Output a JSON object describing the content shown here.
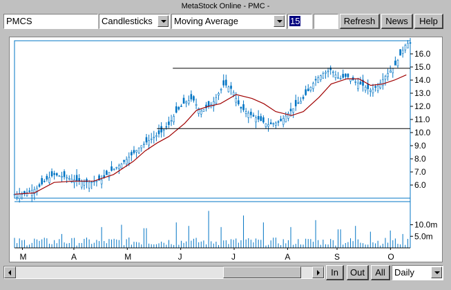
{
  "window": {
    "title": "MetaStock Online - PMC -"
  },
  "toolbar": {
    "symbol": "PMCS",
    "chart_style": "Candlesticks",
    "indicator": "Moving Average",
    "period": "15",
    "refresh_label": "Refresh",
    "news_label": "News",
    "help_label": "Help"
  },
  "bottom": {
    "in_label": "In",
    "out_label": "Out",
    "all_label": "All",
    "periodicity": "Daily"
  },
  "colors": {
    "price": "#0074c4",
    "moving_average": "#a00000",
    "volume": "#0074c4",
    "lines": "#000000"
  },
  "chart_data": {
    "type": "candlestick",
    "x_months": [
      "M",
      "A",
      "M",
      "J",
      "J",
      "A",
      "S",
      "O"
    ],
    "price_axis": {
      "ticks": [
        "16.0",
        "15.0",
        "14.0",
        "13.0",
        "12.0",
        "11.0",
        "10.0",
        "9.0",
        "8.0",
        "7.0",
        "6.0"
      ],
      "ylim": [
        5.0,
        17.0
      ]
    },
    "volume_axis": {
      "ticks": [
        "10.0m",
        "5.0m"
      ]
    },
    "trendlines": [
      {
        "y": 14.9,
        "x_start": 0.4,
        "x_end": 1.0
      },
      {
        "y": 10.3,
        "x_start": 0.36,
        "x_end": 1.0
      }
    ],
    "close_path": [
      [
        0.0,
        5.3
      ],
      [
        0.03,
        5.4
      ],
      [
        0.06,
        5.8
      ],
      [
        0.08,
        6.4
      ],
      [
        0.1,
        6.8
      ],
      [
        0.13,
        6.6
      ],
      [
        0.16,
        6.3
      ],
      [
        0.19,
        6.2
      ],
      [
        0.22,
        6.4
      ],
      [
        0.24,
        7.0
      ],
      [
        0.27,
        7.6
      ],
      [
        0.3,
        8.4
      ],
      [
        0.32,
        9.0
      ],
      [
        0.35,
        9.6
      ],
      [
        0.37,
        10.0
      ],
      [
        0.39,
        10.6
      ],
      [
        0.41,
        11.6
      ],
      [
        0.43,
        12.3
      ],
      [
        0.45,
        12.6
      ],
      [
        0.47,
        11.6
      ],
      [
        0.5,
        12.2
      ],
      [
        0.53,
        13.7
      ],
      [
        0.55,
        13.3
      ],
      [
        0.57,
        11.9
      ],
      [
        0.6,
        11.3
      ],
      [
        0.64,
        10.6
      ],
      [
        0.67,
        10.8
      ],
      [
        0.7,
        11.7
      ],
      [
        0.73,
        12.6
      ],
      [
        0.76,
        14.0
      ],
      [
        0.78,
        14.5
      ],
      [
        0.8,
        14.8
      ],
      [
        0.82,
        14.1
      ],
      [
        0.84,
        14.3
      ],
      [
        0.86,
        13.9
      ],
      [
        0.88,
        13.6
      ],
      [
        0.9,
        13.2
      ],
      [
        0.92,
        13.6
      ],
      [
        0.94,
        14.4
      ],
      [
        0.96,
        15.0
      ],
      [
        0.975,
        15.9
      ],
      [
        0.99,
        16.8
      ]
    ],
    "moving_average_path": [
      [
        0.0,
        5.3
      ],
      [
        0.05,
        5.4
      ],
      [
        0.1,
        6.2
      ],
      [
        0.15,
        6.3
      ],
      [
        0.2,
        6.3
      ],
      [
        0.25,
        6.8
      ],
      [
        0.3,
        7.8
      ],
      [
        0.33,
        8.6
      ],
      [
        0.36,
        9.2
      ],
      [
        0.39,
        9.7
      ],
      [
        0.43,
        10.7
      ],
      [
        0.46,
        11.7
      ],
      [
        0.49,
        12.0
      ],
      [
        0.52,
        12.2
      ],
      [
        0.56,
        12.9
      ],
      [
        0.6,
        12.6
      ],
      [
        0.63,
        12.2
      ],
      [
        0.66,
        11.6
      ],
      [
        0.7,
        11.3
      ],
      [
        0.73,
        11.6
      ],
      [
        0.77,
        12.7
      ],
      [
        0.8,
        13.7
      ],
      [
        0.84,
        14.1
      ],
      [
        0.87,
        14.1
      ],
      [
        0.9,
        13.6
      ],
      [
        0.93,
        13.7
      ],
      [
        0.96,
        14.0
      ],
      [
        0.99,
        14.4
      ]
    ],
    "volume_spikes": [
      [
        0.05,
        4.0
      ],
      [
        0.12,
        6.0
      ],
      [
        0.22,
        9.0
      ],
      [
        0.27,
        10.0
      ],
      [
        0.33,
        8.5
      ],
      [
        0.41,
        11.0
      ],
      [
        0.44,
        9.5
      ],
      [
        0.49,
        16.0
      ],
      [
        0.52,
        9.0
      ],
      [
        0.58,
        14.0
      ],
      [
        0.63,
        11.0
      ],
      [
        0.7,
        9.0
      ],
      [
        0.76,
        12.0
      ],
      [
        0.82,
        8.0
      ],
      [
        0.86,
        9.5
      ],
      [
        0.9,
        7.0
      ],
      [
        0.95,
        7.5
      ],
      [
        0.98,
        6.0
      ]
    ]
  }
}
